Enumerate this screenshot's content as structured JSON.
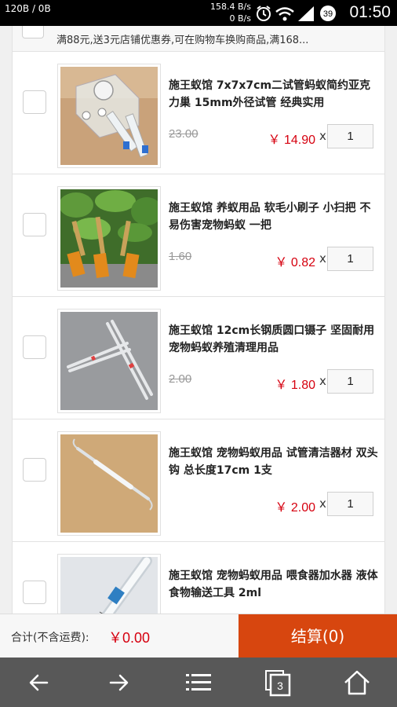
{
  "status_bar": {
    "left_text": "120B / 0B",
    "speed_up": "158.4 B/s",
    "speed_down": "0 B/s",
    "notification_count": "39",
    "time": "01:50"
  },
  "shop": {
    "promo": "满88元,送3元店铺优惠券,可在购物车换购商品,满168..."
  },
  "items": [
    {
      "title": "施王蚁馆 7x7x7cm二试管蚂蚁简约亚克力巢 15mm外径试管 经典实用",
      "old_price": "23.00",
      "price": "￥ 14.90",
      "times": "x",
      "qty": "1"
    },
    {
      "title": "施王蚁馆 养蚁用品 软毛小刷子 小扫把 不易伤害宠物蚂蚁 一把",
      "old_price": "1.60",
      "price": "￥ 0.82",
      "times": "x",
      "qty": "1"
    },
    {
      "title": "施王蚁馆 12cm长钢质圆口镊子 坚固耐用 宠物蚂蚁养殖清理用品",
      "old_price": "2.00",
      "price": "￥ 1.80",
      "times": "x",
      "qty": "1"
    },
    {
      "title": "施王蚁馆 宠物蚂蚁用品 试管清洁器材 双头钩 总长度17cm 1支",
      "old_price": "",
      "price": "￥ 2.00",
      "times": "x",
      "qty": "1"
    },
    {
      "title": "施王蚁馆 宠物蚂蚁用品 喂食器加水器 液体食物输送工具 2ml",
      "old_price": "",
      "price": "",
      "times": "",
      "qty": ""
    }
  ],
  "checkout": {
    "total_label": "合计(不含运费):",
    "total_value": "￥0.00",
    "button_label": "结算(0)"
  },
  "nav": {
    "tabs_count": "3"
  },
  "colors": {
    "accent": "#d7460f",
    "price_red": "#d6000f",
    "nav_bg": "#585858"
  }
}
